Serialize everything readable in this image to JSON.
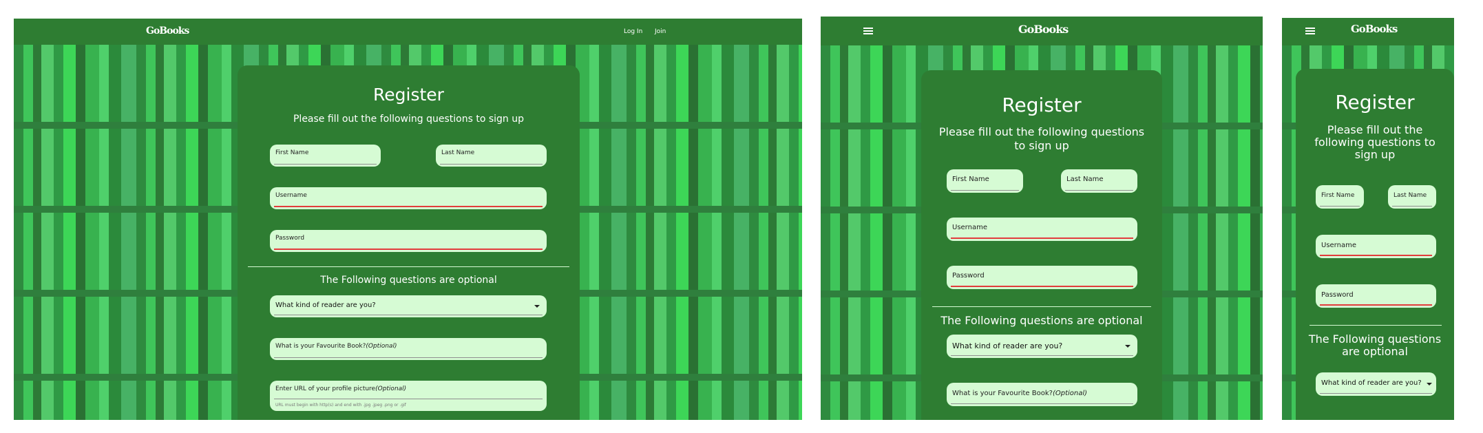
{
  "app": {
    "brand": "GoBooks"
  },
  "nav": {
    "login": "Log In",
    "join": "Join"
  },
  "form": {
    "title": "Register",
    "subtitle": "Please fill out the following questions to sign up",
    "first_name": "First Name",
    "last_name": "Last Name",
    "username": "Username",
    "password": "Password",
    "optional_heading": "The Following questions are optional",
    "reader_select": "What kind of reader are you?",
    "favourite_book": "What is your Favourite Book?",
    "profile_picture": "Enter URL of your profile picture",
    "optional_tag": "(Optional)",
    "url_hint": "URL must begin with http(s) and end with .jpg .jpeg .png or .gif"
  },
  "colors": {
    "nav": "#2e7d32",
    "card": "#2e7d32",
    "field": "#d6fbd4",
    "error_line": "#e23b3b",
    "background": "#47b265"
  }
}
